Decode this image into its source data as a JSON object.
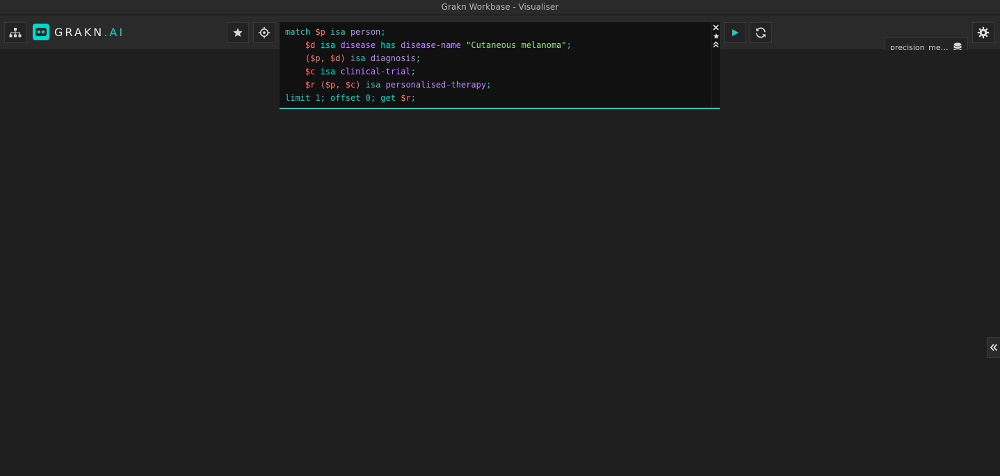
{
  "window": {
    "title": "Grakn Workbase - Visualiser"
  },
  "logo": {
    "text_main": "GRAKN",
    "text_dot_ai": ".AI"
  },
  "toolbar": {
    "schema_design_icon": "sitemap-icon",
    "favourites_icon": "star-icon",
    "focus_icon": "crosshair-icon",
    "run_icon": "play-icon",
    "refresh_icon": "refresh-icon",
    "settings_icon": "gear-icon"
  },
  "query_editor": {
    "lines": [
      [
        [
          "kw",
          "match "
        ],
        [
          "var",
          "$p"
        ],
        [
          "kw",
          " isa "
        ],
        [
          "type",
          "person"
        ],
        [
          "kw",
          ";"
        ]
      ],
      [
        [
          "plain",
          "    "
        ],
        [
          "var",
          "$d"
        ],
        [
          "kw",
          " isa "
        ],
        [
          "type",
          "disease"
        ],
        [
          "kw",
          " has "
        ],
        [
          "type",
          "disease-name"
        ],
        [
          "plain",
          " "
        ],
        [
          "str",
          "\"Cutaneous melanoma\""
        ],
        [
          "kw",
          ";"
        ]
      ],
      [
        [
          "plain",
          "    "
        ],
        [
          "var",
          "("
        ],
        [
          "var",
          "$p"
        ],
        [
          "var",
          ", "
        ],
        [
          "var",
          "$d"
        ],
        [
          "var",
          ")"
        ],
        [
          "kw",
          " isa "
        ],
        [
          "type",
          "diagnosis"
        ],
        [
          "kw",
          ";"
        ]
      ],
      [
        [
          "plain",
          "    "
        ],
        [
          "var",
          "$c"
        ],
        [
          "kw",
          " isa "
        ],
        [
          "type",
          "clinical-trial"
        ],
        [
          "kw",
          ";"
        ]
      ],
      [
        [
          "plain",
          "    "
        ],
        [
          "var",
          "$r"
        ],
        [
          "plain",
          " "
        ],
        [
          "var",
          "("
        ],
        [
          "var",
          "$p"
        ],
        [
          "var",
          ", "
        ],
        [
          "var",
          "$c"
        ],
        [
          "var",
          ")"
        ],
        [
          "kw",
          " isa "
        ],
        [
          "type",
          "personalised-therapy"
        ],
        [
          "kw",
          ";"
        ]
      ],
      [
        [
          "kw",
          "limit "
        ],
        [
          "num",
          "1"
        ],
        [
          "kw",
          "; offset "
        ],
        [
          "num",
          "0"
        ],
        [
          "kw",
          "; get "
        ],
        [
          "var",
          "$r"
        ],
        [
          "kw",
          ";"
        ]
      ]
    ],
    "side_icons": [
      "close-icon",
      "star-icon",
      "collapse-up-icon"
    ]
  },
  "database": {
    "selected": "precision_medicine",
    "icon": "database-icon"
  },
  "side_panel": {
    "toggle_icon": "double-chevron-left-icon"
  },
  "colors": {
    "accent": "#02dac9",
    "keyword": "#02dac9",
    "variable": "#ff7878",
    "type": "#bd8bff",
    "string": "#9ce08b",
    "background": "#1f1f1f",
    "bar": "#2a2a2a"
  }
}
